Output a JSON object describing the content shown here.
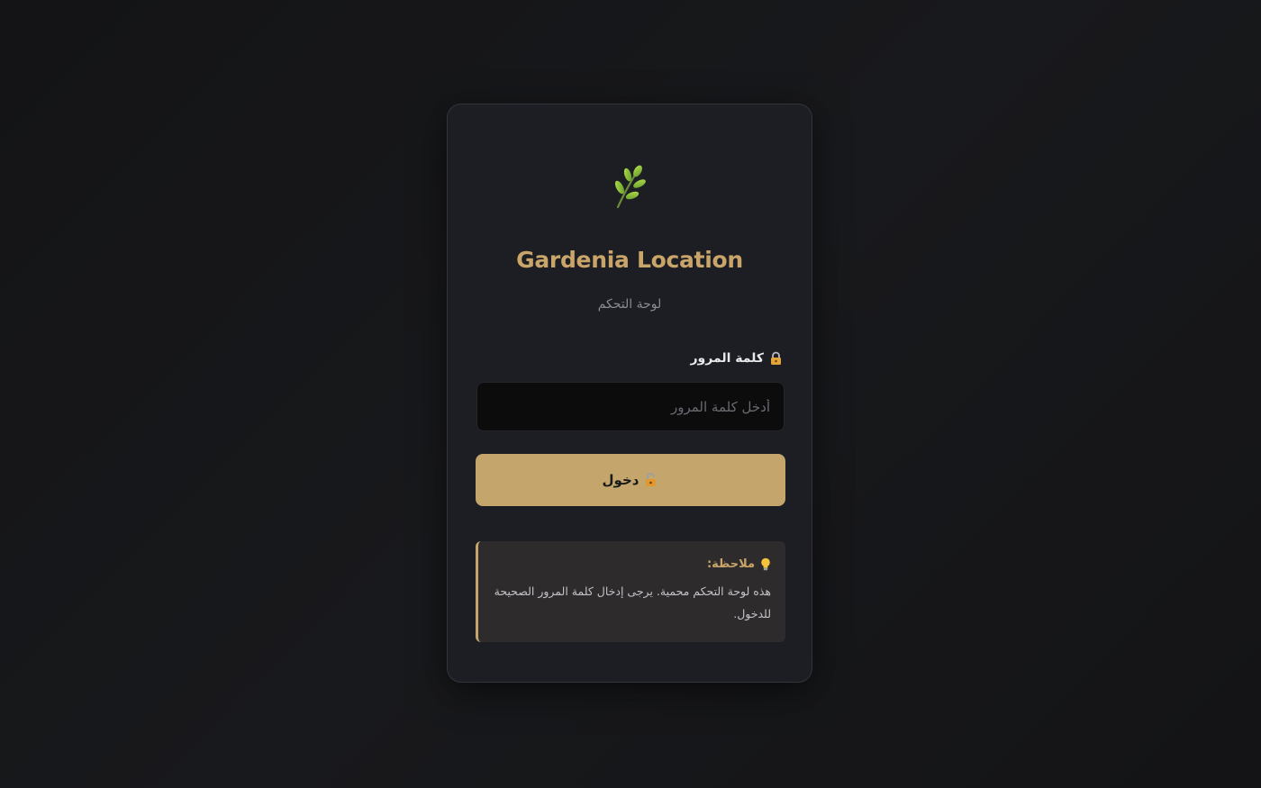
{
  "brand": {
    "logo_icon": "leaf-sprig-icon",
    "title": "Gardenia Location",
    "subtitle": "لوحة التحكم"
  },
  "login_form": {
    "password_label": "كلمة المرور",
    "password_label_icon": "lock-icon",
    "password_placeholder": "أدخل كلمة المرور",
    "password_value": "",
    "submit_label": "دخول",
    "submit_icon": "unlock-icon"
  },
  "note": {
    "icon": "lightbulb-icon",
    "title": "ملاحظة:",
    "text": "هذه لوحة التحكم محمية. يرجى إدخال كلمة المرور الصحيحة للدخول."
  },
  "colors": {
    "accent": "#c4a56c",
    "title": "#c9a56a",
    "card_background": "#1d1e24",
    "page_background": "#141416",
    "input_background": "#0c0c0d",
    "note_background": "#2d2b2b"
  }
}
